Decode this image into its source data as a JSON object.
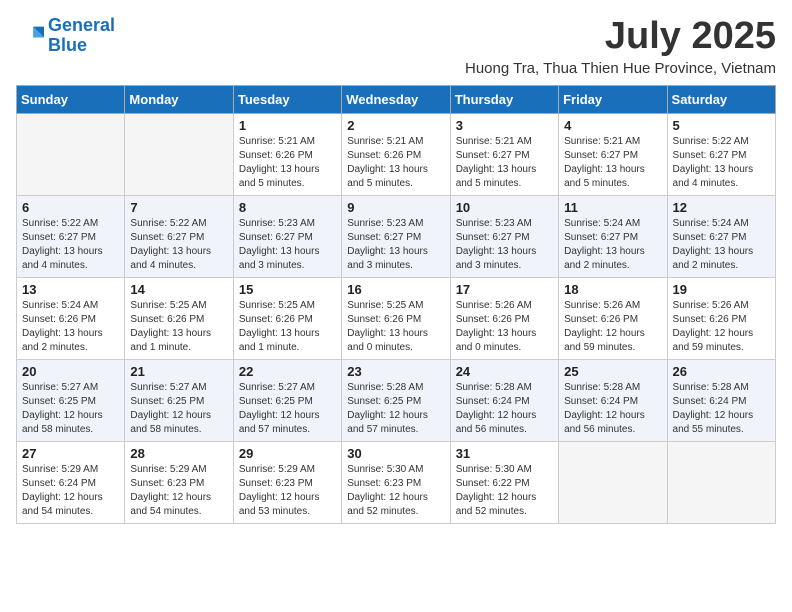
{
  "logo": {
    "line1": "General",
    "line2": "Blue"
  },
  "title": "July 2025",
  "location": "Huong Tra, Thua Thien Hue Province, Vietnam",
  "days_of_week": [
    "Sunday",
    "Monday",
    "Tuesday",
    "Wednesday",
    "Thursday",
    "Friday",
    "Saturday"
  ],
  "weeks": [
    [
      {
        "day": "",
        "sunrise": "",
        "sunset": "",
        "daylight": ""
      },
      {
        "day": "",
        "sunrise": "",
        "sunset": "",
        "daylight": ""
      },
      {
        "day": "1",
        "sunrise": "Sunrise: 5:21 AM",
        "sunset": "Sunset: 6:26 PM",
        "daylight": "Daylight: 13 hours and 5 minutes."
      },
      {
        "day": "2",
        "sunrise": "Sunrise: 5:21 AM",
        "sunset": "Sunset: 6:26 PM",
        "daylight": "Daylight: 13 hours and 5 minutes."
      },
      {
        "day": "3",
        "sunrise": "Sunrise: 5:21 AM",
        "sunset": "Sunset: 6:27 PM",
        "daylight": "Daylight: 13 hours and 5 minutes."
      },
      {
        "day": "4",
        "sunrise": "Sunrise: 5:21 AM",
        "sunset": "Sunset: 6:27 PM",
        "daylight": "Daylight: 13 hours and 5 minutes."
      },
      {
        "day": "5",
        "sunrise": "Sunrise: 5:22 AM",
        "sunset": "Sunset: 6:27 PM",
        "daylight": "Daylight: 13 hours and 4 minutes."
      }
    ],
    [
      {
        "day": "6",
        "sunrise": "Sunrise: 5:22 AM",
        "sunset": "Sunset: 6:27 PM",
        "daylight": "Daylight: 13 hours and 4 minutes."
      },
      {
        "day": "7",
        "sunrise": "Sunrise: 5:22 AM",
        "sunset": "Sunset: 6:27 PM",
        "daylight": "Daylight: 13 hours and 4 minutes."
      },
      {
        "day": "8",
        "sunrise": "Sunrise: 5:23 AM",
        "sunset": "Sunset: 6:27 PM",
        "daylight": "Daylight: 13 hours and 3 minutes."
      },
      {
        "day": "9",
        "sunrise": "Sunrise: 5:23 AM",
        "sunset": "Sunset: 6:27 PM",
        "daylight": "Daylight: 13 hours and 3 minutes."
      },
      {
        "day": "10",
        "sunrise": "Sunrise: 5:23 AM",
        "sunset": "Sunset: 6:27 PM",
        "daylight": "Daylight: 13 hours and 3 minutes."
      },
      {
        "day": "11",
        "sunrise": "Sunrise: 5:24 AM",
        "sunset": "Sunset: 6:27 PM",
        "daylight": "Daylight: 13 hours and 2 minutes."
      },
      {
        "day": "12",
        "sunrise": "Sunrise: 5:24 AM",
        "sunset": "Sunset: 6:27 PM",
        "daylight": "Daylight: 13 hours and 2 minutes."
      }
    ],
    [
      {
        "day": "13",
        "sunrise": "Sunrise: 5:24 AM",
        "sunset": "Sunset: 6:26 PM",
        "daylight": "Daylight: 13 hours and 2 minutes."
      },
      {
        "day": "14",
        "sunrise": "Sunrise: 5:25 AM",
        "sunset": "Sunset: 6:26 PM",
        "daylight": "Daylight: 13 hours and 1 minute."
      },
      {
        "day": "15",
        "sunrise": "Sunrise: 5:25 AM",
        "sunset": "Sunset: 6:26 PM",
        "daylight": "Daylight: 13 hours and 1 minute."
      },
      {
        "day": "16",
        "sunrise": "Sunrise: 5:25 AM",
        "sunset": "Sunset: 6:26 PM",
        "daylight": "Daylight: 13 hours and 0 minutes."
      },
      {
        "day": "17",
        "sunrise": "Sunrise: 5:26 AM",
        "sunset": "Sunset: 6:26 PM",
        "daylight": "Daylight: 13 hours and 0 minutes."
      },
      {
        "day": "18",
        "sunrise": "Sunrise: 5:26 AM",
        "sunset": "Sunset: 6:26 PM",
        "daylight": "Daylight: 12 hours and 59 minutes."
      },
      {
        "day": "19",
        "sunrise": "Sunrise: 5:26 AM",
        "sunset": "Sunset: 6:26 PM",
        "daylight": "Daylight: 12 hours and 59 minutes."
      }
    ],
    [
      {
        "day": "20",
        "sunrise": "Sunrise: 5:27 AM",
        "sunset": "Sunset: 6:25 PM",
        "daylight": "Daylight: 12 hours and 58 minutes."
      },
      {
        "day": "21",
        "sunrise": "Sunrise: 5:27 AM",
        "sunset": "Sunset: 6:25 PM",
        "daylight": "Daylight: 12 hours and 58 minutes."
      },
      {
        "day": "22",
        "sunrise": "Sunrise: 5:27 AM",
        "sunset": "Sunset: 6:25 PM",
        "daylight": "Daylight: 12 hours and 57 minutes."
      },
      {
        "day": "23",
        "sunrise": "Sunrise: 5:28 AM",
        "sunset": "Sunset: 6:25 PM",
        "daylight": "Daylight: 12 hours and 57 minutes."
      },
      {
        "day": "24",
        "sunrise": "Sunrise: 5:28 AM",
        "sunset": "Sunset: 6:24 PM",
        "daylight": "Daylight: 12 hours and 56 minutes."
      },
      {
        "day": "25",
        "sunrise": "Sunrise: 5:28 AM",
        "sunset": "Sunset: 6:24 PM",
        "daylight": "Daylight: 12 hours and 56 minutes."
      },
      {
        "day": "26",
        "sunrise": "Sunrise: 5:28 AM",
        "sunset": "Sunset: 6:24 PM",
        "daylight": "Daylight: 12 hours and 55 minutes."
      }
    ],
    [
      {
        "day": "27",
        "sunrise": "Sunrise: 5:29 AM",
        "sunset": "Sunset: 6:24 PM",
        "daylight": "Daylight: 12 hours and 54 minutes."
      },
      {
        "day": "28",
        "sunrise": "Sunrise: 5:29 AM",
        "sunset": "Sunset: 6:23 PM",
        "daylight": "Daylight: 12 hours and 54 minutes."
      },
      {
        "day": "29",
        "sunrise": "Sunrise: 5:29 AM",
        "sunset": "Sunset: 6:23 PM",
        "daylight": "Daylight: 12 hours and 53 minutes."
      },
      {
        "day": "30",
        "sunrise": "Sunrise: 5:30 AM",
        "sunset": "Sunset: 6:23 PM",
        "daylight": "Daylight: 12 hours and 52 minutes."
      },
      {
        "day": "31",
        "sunrise": "Sunrise: 5:30 AM",
        "sunset": "Sunset: 6:22 PM",
        "daylight": "Daylight: 12 hours and 52 minutes."
      },
      {
        "day": "",
        "sunrise": "",
        "sunset": "",
        "daylight": ""
      },
      {
        "day": "",
        "sunrise": "",
        "sunset": "",
        "daylight": ""
      }
    ]
  ]
}
